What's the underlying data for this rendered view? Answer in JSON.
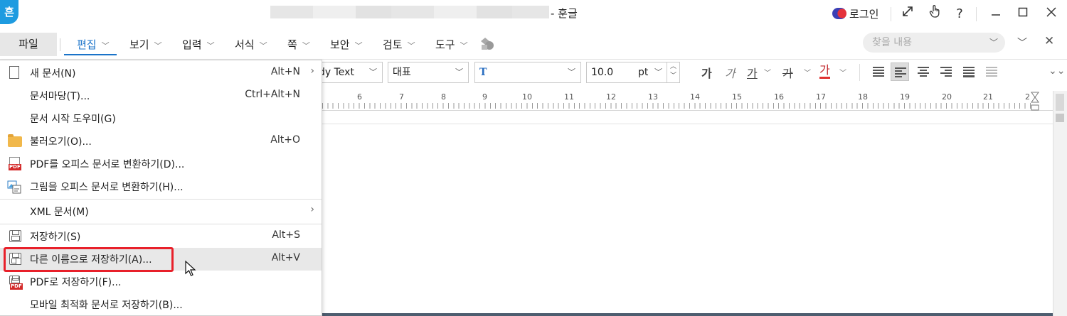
{
  "titlebar": {
    "app_logo": "흔",
    "doc_title": "- 훈글",
    "login_label": "로그인",
    "buttons": [
      "expand-icon",
      "touch-icon",
      "help-icon",
      "minimize-icon",
      "maximize-icon",
      "close-icon"
    ],
    "help_glyph": "?"
  },
  "menubar": {
    "file_tab": "파일",
    "items": [
      "편집",
      "보기",
      "입력",
      "서식",
      "쪽",
      "보안",
      "검토",
      "도구"
    ],
    "active_item": "편집",
    "search_placeholder": "찾을 내용"
  },
  "toolbar": {
    "style_value": "dy Text",
    "font_kind": "대표",
    "font_size": "10.0",
    "font_unit": "pt",
    "format_buttons": [
      "가",
      "가",
      "가",
      "가",
      "가"
    ]
  },
  "ruler": {
    "numbers": [
      "6",
      "7",
      "8",
      "9",
      "10",
      "11",
      "12",
      "13",
      "14",
      "15",
      "16",
      "17",
      "18",
      "19",
      "20",
      "21",
      "2"
    ]
  },
  "file_menu": {
    "items": [
      {
        "label": "새 문서(N)",
        "shortcut": "Alt+N",
        "icon": "new-document-icon",
        "submenu": true
      },
      {
        "label": "문서마당(T)...",
        "shortcut": "Ctrl+Alt+N",
        "icon": "",
        "submenu": false
      },
      {
        "label": "문서 시작 도우미(G)",
        "shortcut": "",
        "icon": "",
        "submenu": false
      },
      {
        "label": "불러오기(O)...",
        "shortcut": "Alt+O",
        "icon": "open-folder-icon",
        "submenu": false
      },
      {
        "label": "PDF를 오피스 문서로 변환하기(D)...",
        "shortcut": "",
        "icon": "pdf-convert-icon",
        "submenu": false
      },
      {
        "label": "그림을 오피스 문서로 변환하기(H)...",
        "shortcut": "",
        "icon": "image-convert-icon",
        "submenu": false
      },
      {
        "label": "XML 문서(M)",
        "shortcut": "",
        "icon": "",
        "submenu": true
      },
      {
        "label": "저장하기(S)",
        "shortcut": "Alt+S",
        "icon": "save-icon",
        "submenu": false
      },
      {
        "label": "다른 이름으로 저장하기(A)...",
        "shortcut": "Alt+V",
        "icon": "save-as-icon",
        "submenu": false
      },
      {
        "label": "PDF로 저장하기(F)...",
        "shortcut": "",
        "icon": "save-pdf-icon",
        "submenu": false
      },
      {
        "label": "모바일 최적화 문서로 저장하기(B)...",
        "shortcut": "",
        "icon": "",
        "submenu": false
      }
    ],
    "highlighted_item": "다른 이름으로 저장하기(A)..."
  },
  "colors": {
    "accent": "#1a73c9",
    "highlight_border": "#e8202a",
    "logo_bg": "#1e9be0"
  }
}
